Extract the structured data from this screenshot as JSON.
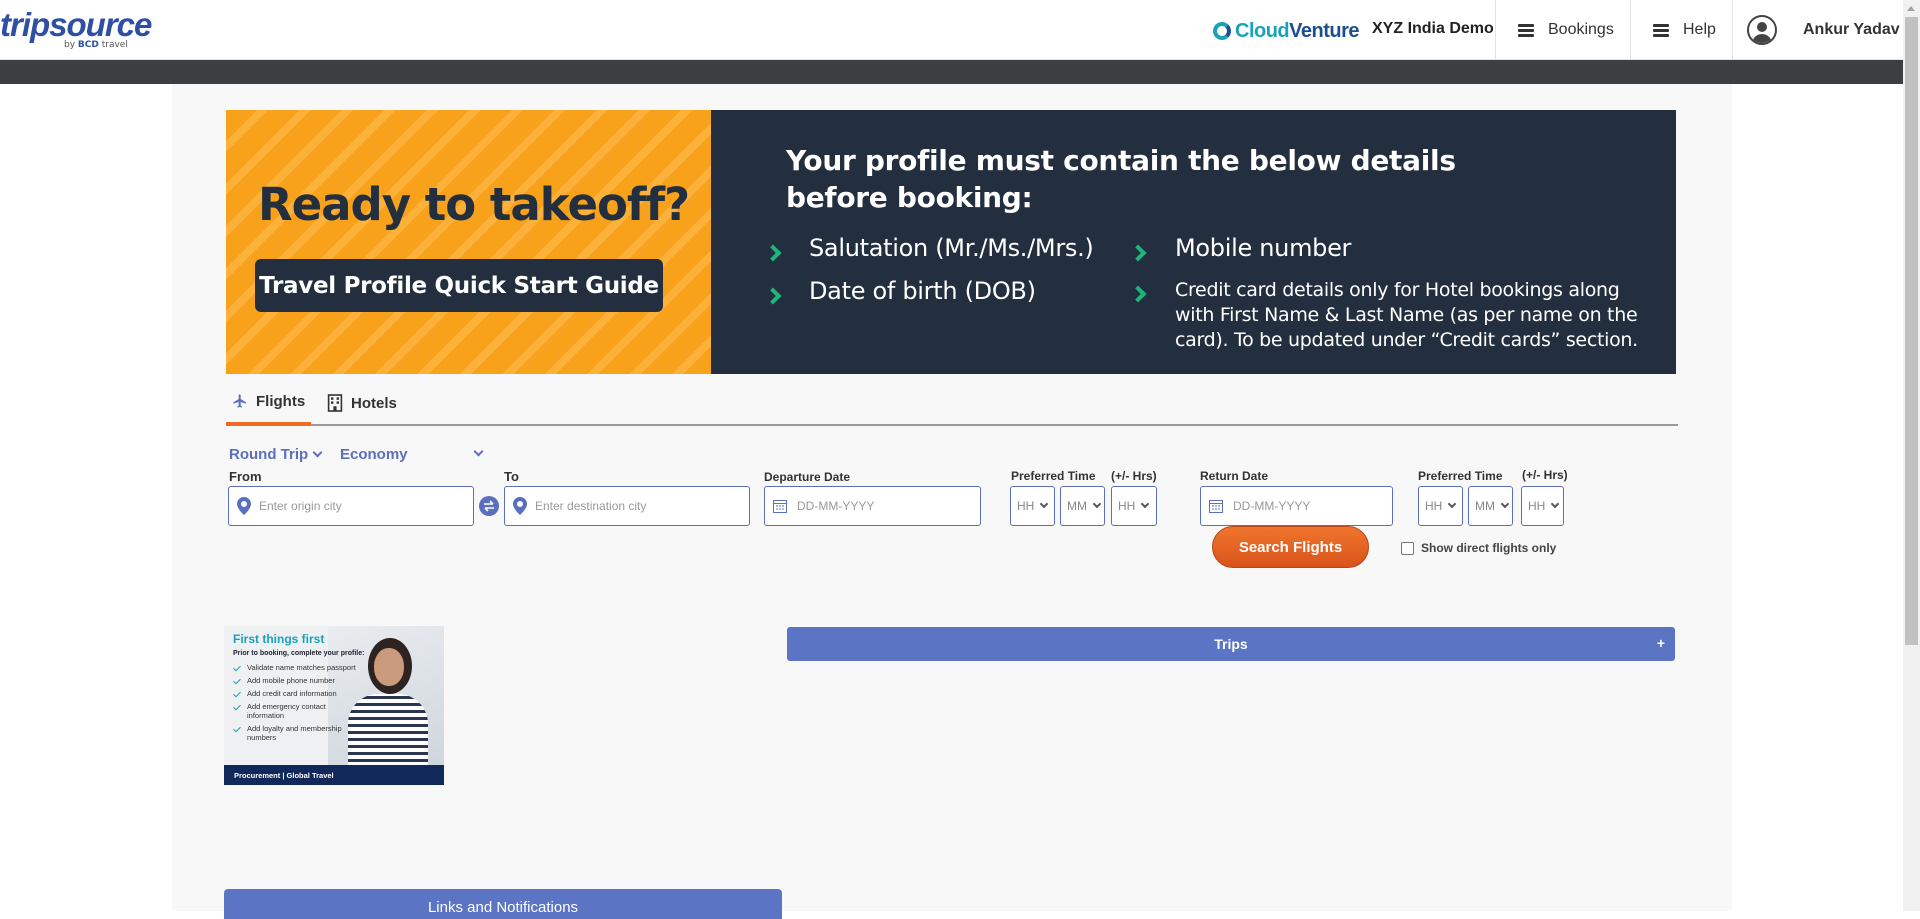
{
  "header": {
    "logo_main": "tripsource",
    "logo_by": "by",
    "logo_brand": "BCD",
    "logo_travel": "travel",
    "partner_logo_a": "Cloud",
    "partner_logo_b": "Venture",
    "company": "XYZ India Demo",
    "bookings_label": "Bookings",
    "help_label": "Help",
    "user_name": "Ankur Yadav"
  },
  "banner": {
    "title": "Ready to takeoff?",
    "button_label": "Travel Profile Quick Start Guide",
    "heading": "Your profile must contain the below details before booking:",
    "items": [
      "Salutation (Mr./Ms./Mrs.)",
      "Date of birth (DOB)",
      "Mobile number",
      "Credit card details only for Hotel bookings along with First Name & Last Name (as per name on the card). To be updated under “Credit cards” section."
    ]
  },
  "tabs": [
    {
      "label": "Flights",
      "icon": "plane-icon",
      "active": true
    },
    {
      "label": "Hotels",
      "icon": "building-icon",
      "active": false
    }
  ],
  "search": {
    "trip_type": "Round Trip",
    "cabin_class": "Economy",
    "from_label": "From",
    "from_placeholder": "Enter origin city",
    "to_label": "To",
    "to_placeholder": "Enter destination city",
    "departure_label": "Departure Date",
    "departure_placeholder": "DD-MM-YYYY",
    "pref_time_label": "Preferred Time",
    "hrs_label": "(+/- Hrs)",
    "return_label": "Return Date",
    "return_placeholder": "DD-MM-YYYY",
    "hh": "HH",
    "mm": "MM",
    "search_button": "Search Flights",
    "direct_only_label": "Show direct flights only",
    "direct_only_checked": false
  },
  "promo": {
    "title": "First things first",
    "subtitle": "Prior to booking, complete your profile:",
    "items": [
      "Validate name matches passport",
      "Add mobile phone number",
      "Add credit card information",
      "Add emergency contact information",
      "Add loyalty and membership numbers"
    ],
    "footer": "Procurement | Global Travel"
  },
  "trips": {
    "label": "Trips",
    "toggle": "+"
  },
  "links": {
    "label": "Links and Notifications"
  },
  "colors": {
    "accent": "#5b74c4",
    "orange": "#f26c22",
    "banner_dark": "#232f3e",
    "banner_orange": "#f7a21a",
    "check_green": "#1db57a"
  }
}
